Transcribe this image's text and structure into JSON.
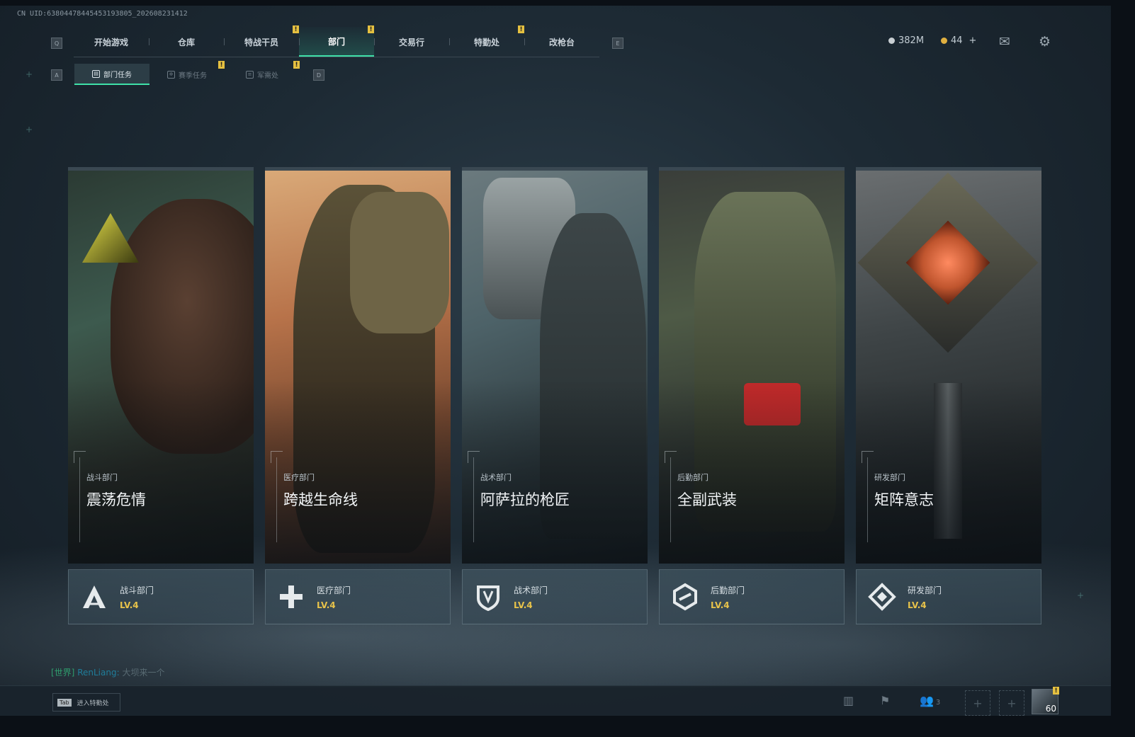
{
  "uid": "CN UID:638044784454531938​05_202608231412",
  "keys": {
    "prev": "Q",
    "next": "E",
    "sub_prev": "A",
    "sub_next": "D"
  },
  "nav": {
    "tabs": [
      {
        "label": "开始游戏",
        "badge": ""
      },
      {
        "label": "仓库",
        "badge": ""
      },
      {
        "label": "特战干员",
        "badge": "!"
      },
      {
        "label": "部门",
        "badge": "!"
      },
      {
        "label": "交易行",
        "badge": ""
      },
      {
        "label": "特勤处",
        "badge": "!"
      },
      {
        "label": "改枪台",
        "badge": ""
      }
    ],
    "active": "部门"
  },
  "subnav": {
    "tabs": [
      {
        "label": "部门任务",
        "badge": ""
      },
      {
        "label": "赛季任务",
        "badge": "!"
      },
      {
        "label": "军需处",
        "badge": "!"
      }
    ],
    "active": "部门任务"
  },
  "currency": {
    "silver": "382M",
    "gold": "44",
    "gold_add": "+",
    "silver_color": "#c8ced2",
    "gold_color": "#e0b040"
  },
  "top_icons": [
    "mail-icon",
    "gear-icon"
  ],
  "departments": [
    {
      "dept": "战斗部门",
      "title": "震荡危情",
      "level": "LV.4",
      "icon": "combat-a-icon",
      "color": "#3d5a4e"
    },
    {
      "dept": "医疗部门",
      "title": "跨越生命线",
      "level": "LV.4",
      "icon": "medical-cross-icon",
      "color": "#b8734a"
    },
    {
      "dept": "战术部门",
      "title": "阿萨拉的枪匠",
      "level": "LV.4",
      "icon": "shield-icon",
      "color": "#4d6268"
    },
    {
      "dept": "后勤部门",
      "title": "全副武装",
      "level": "LV.4",
      "icon": "logistics-link-icon",
      "color": "#4e5a46"
    },
    {
      "dept": "研发部门",
      "title": "矩阵意志",
      "level": "LV.4",
      "icon": "research-diamond-icon",
      "color": "#c0552e"
    }
  ],
  "chat": {
    "channel": "[世界]",
    "name": "RenLiang:",
    "message": "大坝来一个"
  },
  "bottom": {
    "tab_key": "Tab",
    "tab_text": "进入特勤处",
    "friends_count": "3",
    "level": "60"
  },
  "colors": {
    "accent": "#3fe0a8",
    "badge": "#e5c040",
    "level": "#e8c34a"
  }
}
